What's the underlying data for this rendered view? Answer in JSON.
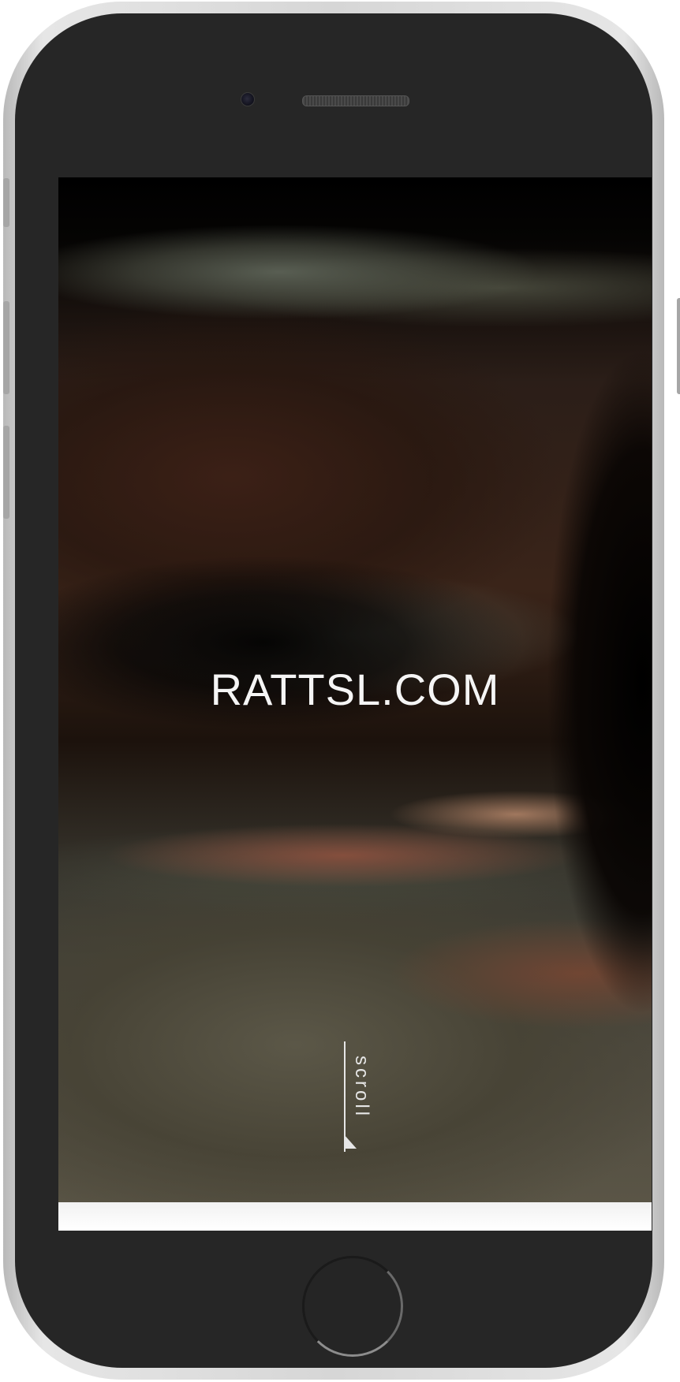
{
  "site": {
    "title": "RATTSL.COM"
  },
  "scroll_indicator": {
    "label": "scroll",
    "icon": "arrow-down-icon"
  },
  "device": {
    "model": "iPhone",
    "home_button_icon": "home-button-icon"
  },
  "colors": {
    "title_text": "#f5f5f5",
    "frame": "#262626",
    "frame_edge": "#d6d6d6"
  }
}
